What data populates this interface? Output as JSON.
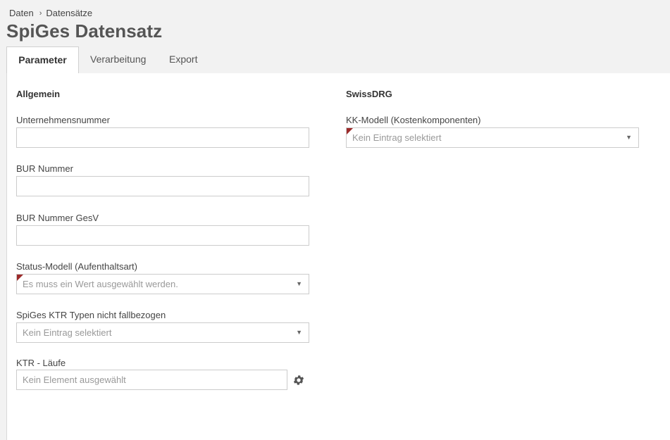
{
  "breadcrumb": {
    "items": [
      "Daten",
      "Datensätze"
    ],
    "separator": "›"
  },
  "page_title": "SpiGes Datensatz",
  "tabs": [
    {
      "label": "Parameter",
      "active": true
    },
    {
      "label": "Verarbeitung",
      "active": false
    },
    {
      "label": "Export",
      "active": false
    }
  ],
  "left": {
    "section_title": "Allgemein",
    "fields": {
      "unternehmensnummer": {
        "label": "Unternehmensnummer",
        "value": ""
      },
      "bur_nummer": {
        "label": "BUR Nummer",
        "value": ""
      },
      "bur_nummer_gesv": {
        "label": "BUR Nummer GesV",
        "value": ""
      },
      "status_modell": {
        "label": "Status-Modell (Aufenthaltsart)",
        "placeholder": "Es muss ein Wert ausgewählt werden.",
        "required": true
      },
      "ktr_typen": {
        "label": "SpiGes KTR Typen nicht fallbezogen",
        "placeholder": "Kein Eintrag selektiert"
      },
      "ktr_laeufe": {
        "label": "KTR - Läufe",
        "placeholder": "Kein Element ausgewählt",
        "settings_icon": "gear-icon"
      }
    }
  },
  "right": {
    "section_title": "SwissDRG",
    "fields": {
      "kk_modell": {
        "label": "KK-Modell (Kostenkomponenten)",
        "placeholder": "Kein Eintrag selektiert",
        "required": true
      }
    }
  },
  "colors": {
    "required_marker": "#9c2a2a",
    "background": "#f2f2f2",
    "panel": "#ffffff"
  }
}
